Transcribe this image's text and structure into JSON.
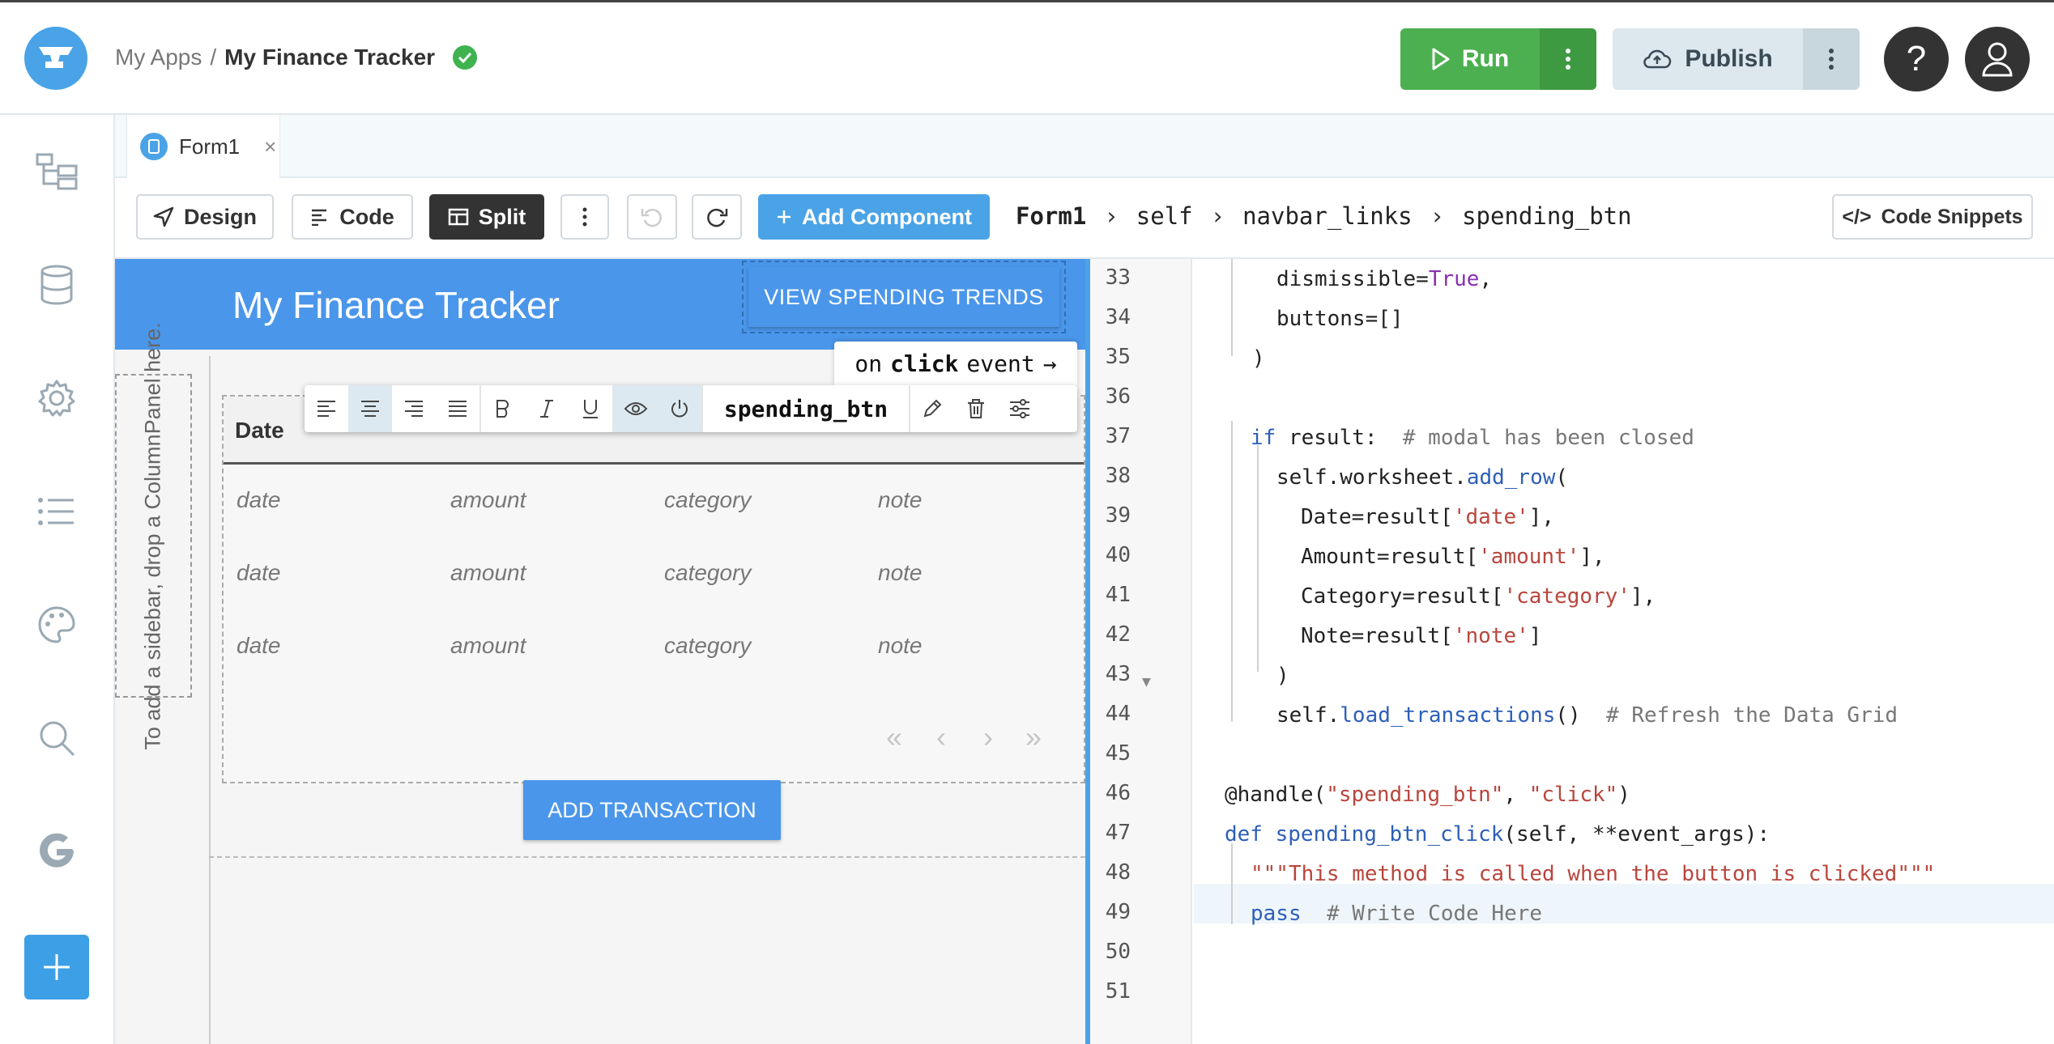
{
  "header": {
    "breadcrumb_root": "My Apps",
    "breadcrumb_sep": "/",
    "app_name": "My Finance Tracker",
    "run_label": "Run",
    "publish_label": "Publish",
    "help_label": "?"
  },
  "tabs": [
    {
      "label": "Form1",
      "close": "×"
    }
  ],
  "toolbar": {
    "design": "Design",
    "code": "Code",
    "split": "Split",
    "add_component": "Add Component",
    "path": [
      "Form1",
      "self",
      "navbar_links",
      "spending_btn"
    ],
    "path_sep": "›",
    "code_snippets": "Code Snippets"
  },
  "design": {
    "app_title": "My Finance Tracker",
    "trend_button": "VIEW SPENDING TRENDS",
    "sidebar_hint": "To add a sidebar, drop a ColumnPanel here.",
    "grid_header": "Date",
    "grid_rows": [
      [
        "date",
        "amount",
        "category",
        "note"
      ],
      [
        "date",
        "amount",
        "category",
        "note"
      ],
      [
        "date",
        "amount",
        "category",
        "note"
      ]
    ],
    "pager": [
      "«",
      "‹",
      "›",
      "»"
    ],
    "add_button": "ADD TRANSACTION",
    "format_toolbar": {
      "component_name": "spending_btn"
    },
    "event_tip": {
      "prefix": "on",
      "event": "click",
      "suffix": "event",
      "arrow": "→"
    }
  },
  "code": {
    "line_numbers": [
      "33",
      "34",
      "35",
      "36",
      "37",
      "38",
      "39",
      "40",
      "41",
      "42",
      "43",
      "44",
      "45",
      "46",
      "47",
      "48",
      "49",
      "50",
      "51"
    ]
  },
  "colors": {
    "accent": "#4aa3e6",
    "run": "#4cb050",
    "navbar": "#4a96ea"
  }
}
